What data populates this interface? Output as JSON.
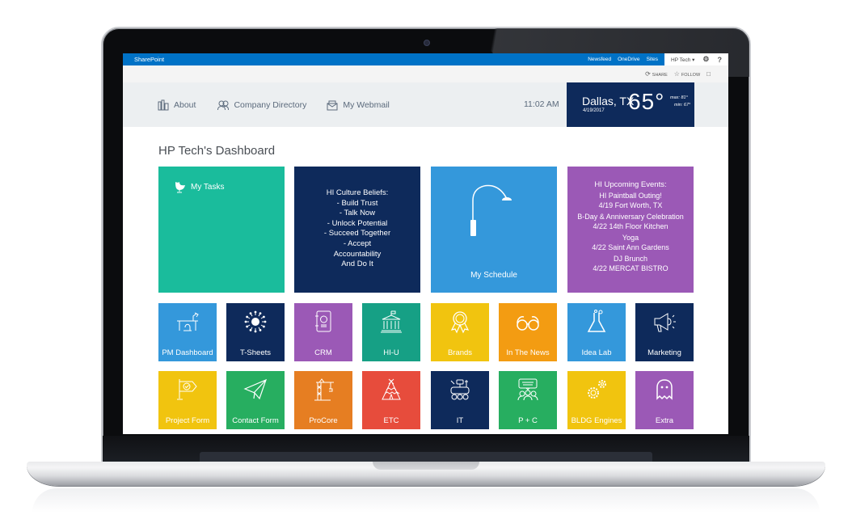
{
  "suitebar": {
    "brand": "SharePoint",
    "links": [
      "Newsfeed",
      "OneDrive",
      "Sites"
    ],
    "user": "HP Tech ▾",
    "settings_icon": "gear-icon",
    "help_label": "?"
  },
  "ribbon": {
    "share_label": "SHARE",
    "follow_label": "FOLLOW",
    "focus_icon": "focus-mode-icon"
  },
  "topnav": {
    "items": [
      {
        "label": "About",
        "icon": "buildings-icon"
      },
      {
        "label": "Company Directory",
        "icon": "people-icon"
      },
      {
        "label": "My Webmail",
        "icon": "mail-icon"
      }
    ],
    "time": "11:02 AM"
  },
  "weather": {
    "city": "Dallas, TX",
    "date": "4/19/2017",
    "temp": "65°",
    "max": "max: 81°",
    "min": "min: 67°"
  },
  "dashboard": {
    "title": "HP Tech's Dashboard",
    "my_tasks": {
      "label": "My Tasks",
      "icon": "egg-chair-icon",
      "color": "#1abc9c"
    },
    "culture": {
      "color": "#0e2a5b",
      "lines": [
        "HI Culture Beliefs:",
        "- Build Trust",
        "- Talk Now",
        "- Unlock Potential",
        "- Succeed Together",
        "- Accept",
        "Accountability",
        "And Do It"
      ]
    },
    "schedule": {
      "label": "My Schedule",
      "icon": "arc-lamp-icon",
      "color": "#3498db"
    },
    "events": {
      "color": "#9b59b6",
      "title": "HI Upcoming Events:",
      "items": [
        {
          "name": "HI Paintball Outing!",
          "detail": "4/19 Fort Worth, TX"
        },
        {
          "name": "B-Day & Anniversary Celebration",
          "detail": "4/22 14th Floor Kitchen"
        },
        {
          "name": "Yoga",
          "detail": "4/22 Saint Ann Gardens"
        },
        {
          "name": "DJ Brunch",
          "detail": "4/22 MERCAT BISTRO"
        }
      ]
    },
    "tiles": [
      {
        "label": "PM Dashboard",
        "icon": "desk-lamp-icon",
        "color": "#3498db"
      },
      {
        "label": "T-Sheets",
        "icon": "burst-icon",
        "color": "#0e2a5b"
      },
      {
        "label": "CRM",
        "icon": "address-book-icon",
        "color": "#9b59b6"
      },
      {
        "label": "HI-U",
        "icon": "university-icon",
        "color": "#16a085"
      },
      {
        "label": "Brands",
        "icon": "award-ribbon-icon",
        "color": "#f1c40f"
      },
      {
        "label": "In The News",
        "icon": "glasses-icon",
        "color": "#f39c12"
      },
      {
        "label": "Idea Lab",
        "icon": "flask-icon",
        "color": "#3498db"
      },
      {
        "label": "Marketing",
        "icon": "megaphone-icon",
        "color": "#0e2a5b"
      },
      {
        "label": "Project Form",
        "icon": "flag-check-icon",
        "color": "#f1c40f"
      },
      {
        "label": "Contact Form",
        "icon": "paper-plane-icon",
        "color": "#27ae60"
      },
      {
        "label": "ProCore",
        "icon": "crane-icon",
        "color": "#e67e22"
      },
      {
        "label": "ETC",
        "icon": "teepee-icon",
        "color": "#e74c3c"
      },
      {
        "label": "IT",
        "icon": "rover-icon",
        "color": "#0e2a5b"
      },
      {
        "label": "P + C",
        "icon": "team-chat-icon",
        "color": "#27ae60"
      },
      {
        "label": "BLDG Engines",
        "icon": "gears-icon",
        "color": "#f1c40f"
      },
      {
        "label": "Extra",
        "icon": "ghost-icon",
        "color": "#9b59b6"
      }
    ]
  }
}
